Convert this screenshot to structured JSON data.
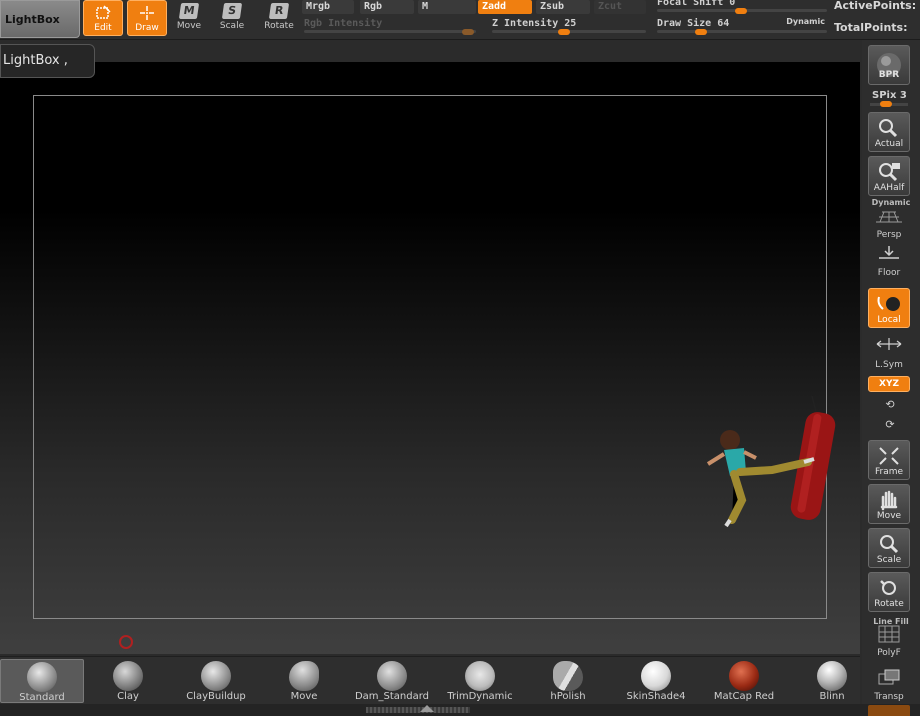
{
  "topbar": {
    "lightbox_label": "LightBox",
    "tools": [
      {
        "label": "Edit",
        "active": true,
        "icon": "edit-icon"
      },
      {
        "label": "Draw",
        "active": true,
        "icon": "draw-icon"
      },
      {
        "label": "Move",
        "glyph": "M",
        "icon": "move-icon"
      },
      {
        "label": "Scale",
        "glyph": "S",
        "icon": "scale-icon"
      },
      {
        "label": "Rotate",
        "glyph": "R",
        "icon": "rotate-icon"
      }
    ],
    "modes": {
      "mrgb": "Mrgb",
      "rgb": "Rgb",
      "m": "M",
      "zadd": "Zadd",
      "zsub": "Zsub",
      "zcut": "Zcut"
    },
    "rgb_intensity_label": "Rgb Intensity",
    "z_intensity_label": "Z Intensity 25",
    "z_intensity_value": 25,
    "focal_shift_label": "Focal Shift 0",
    "focal_shift_value": 0,
    "draw_size_label": "Draw Size 64",
    "draw_size_value": 64,
    "dynamic_label": "Dynamic",
    "active_points_label": "ActivePoints:",
    "total_points_label": "TotalPoints:"
  },
  "canvas": {
    "lightbox_tab_label": "LightBox ,"
  },
  "shelf": {
    "bpr_label": "BPR",
    "spix_label": "SPix 3",
    "actual_label": "Actual",
    "aahalf_label": "AAHalf",
    "dynamic_label": "Dynamic",
    "persp_label": "Persp",
    "floor_label": "Floor",
    "local_label": "Local",
    "lsym_label": "L.Sym",
    "xyz_label": "XYZ",
    "frame_label": "Frame",
    "move_label": "Move",
    "scale_label": "Scale",
    "rotate_label": "Rotate",
    "linefill_label": "Line Fill",
    "polyf_label": "PolyF",
    "transp_label": "Transp"
  },
  "brushes": [
    {
      "label": "Standard",
      "active": true
    },
    {
      "label": "Clay"
    },
    {
      "label": "ClayBuildup"
    },
    {
      "label": "Move"
    },
    {
      "label": "Dam_Standard"
    },
    {
      "label": "TrimDynamic"
    },
    {
      "label": "hPolish"
    },
    {
      "label": "SkinShade4"
    },
    {
      "label": "MatCap Red Wax"
    },
    {
      "label": "Blinn"
    }
  ],
  "colors": {
    "accent": "#f07f10",
    "panel": "#2e2e2e",
    "canvas_top": "#000000",
    "canvas_bottom": "#3f3f3f"
  }
}
